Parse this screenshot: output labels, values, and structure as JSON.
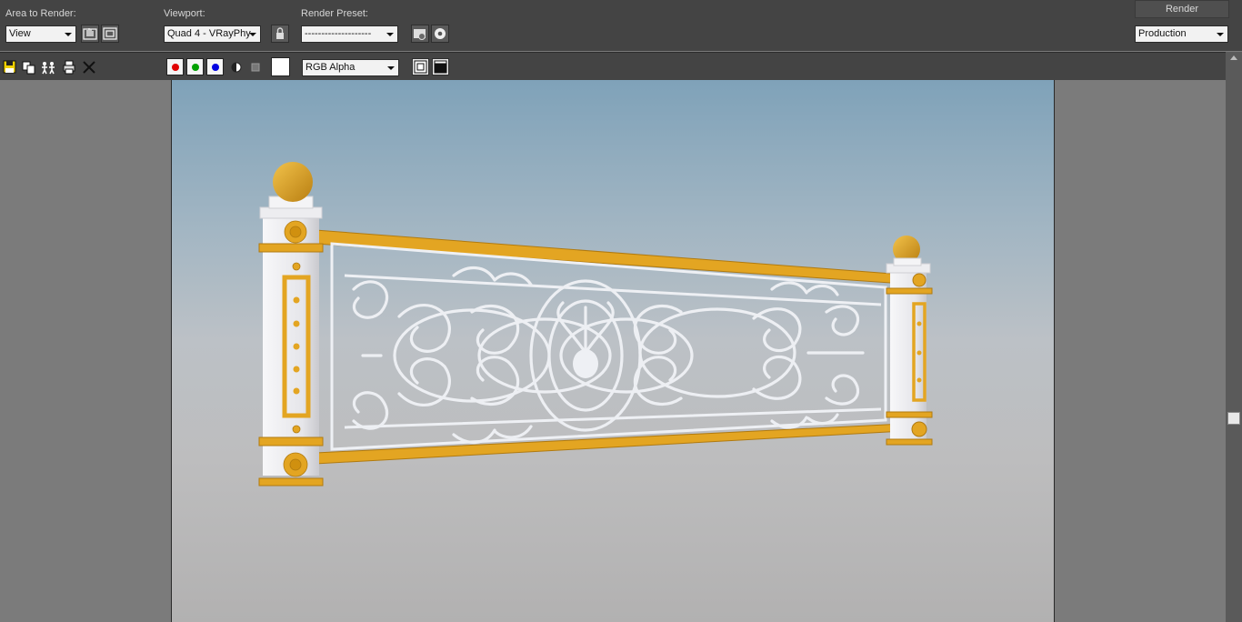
{
  "toolbar": {
    "area_label": "Area to Render:",
    "area_value": "View",
    "viewport_label": "Viewport:",
    "viewport_value": "Quad 4 - VRayPhy",
    "preset_label": "Render Preset:",
    "preset_value": "--------------------",
    "render_button": "Render",
    "mode_value": "Production"
  },
  "toolbar2": {
    "channel_value": "RGB Alpha",
    "colors": {
      "red": "#e00000",
      "green": "#00a000",
      "blue": "#0000e0"
    }
  },
  "icons": [
    "edit-region-icon",
    "auto-region-icon",
    "lock-icon",
    "environment-effects-icon",
    "render-settings-icon",
    "save-icon",
    "copy-icon",
    "clone-frame-icon",
    "print-icon",
    "clear-icon",
    "monochrome-icon",
    "clear-swatch-icon",
    "display-alpha-icon",
    "display-rgb-icon"
  ],
  "scene": {
    "description_colors": {
      "gold": "#e0a21f",
      "white": "#f2f2f4",
      "iron": "#eceef2"
    }
  }
}
